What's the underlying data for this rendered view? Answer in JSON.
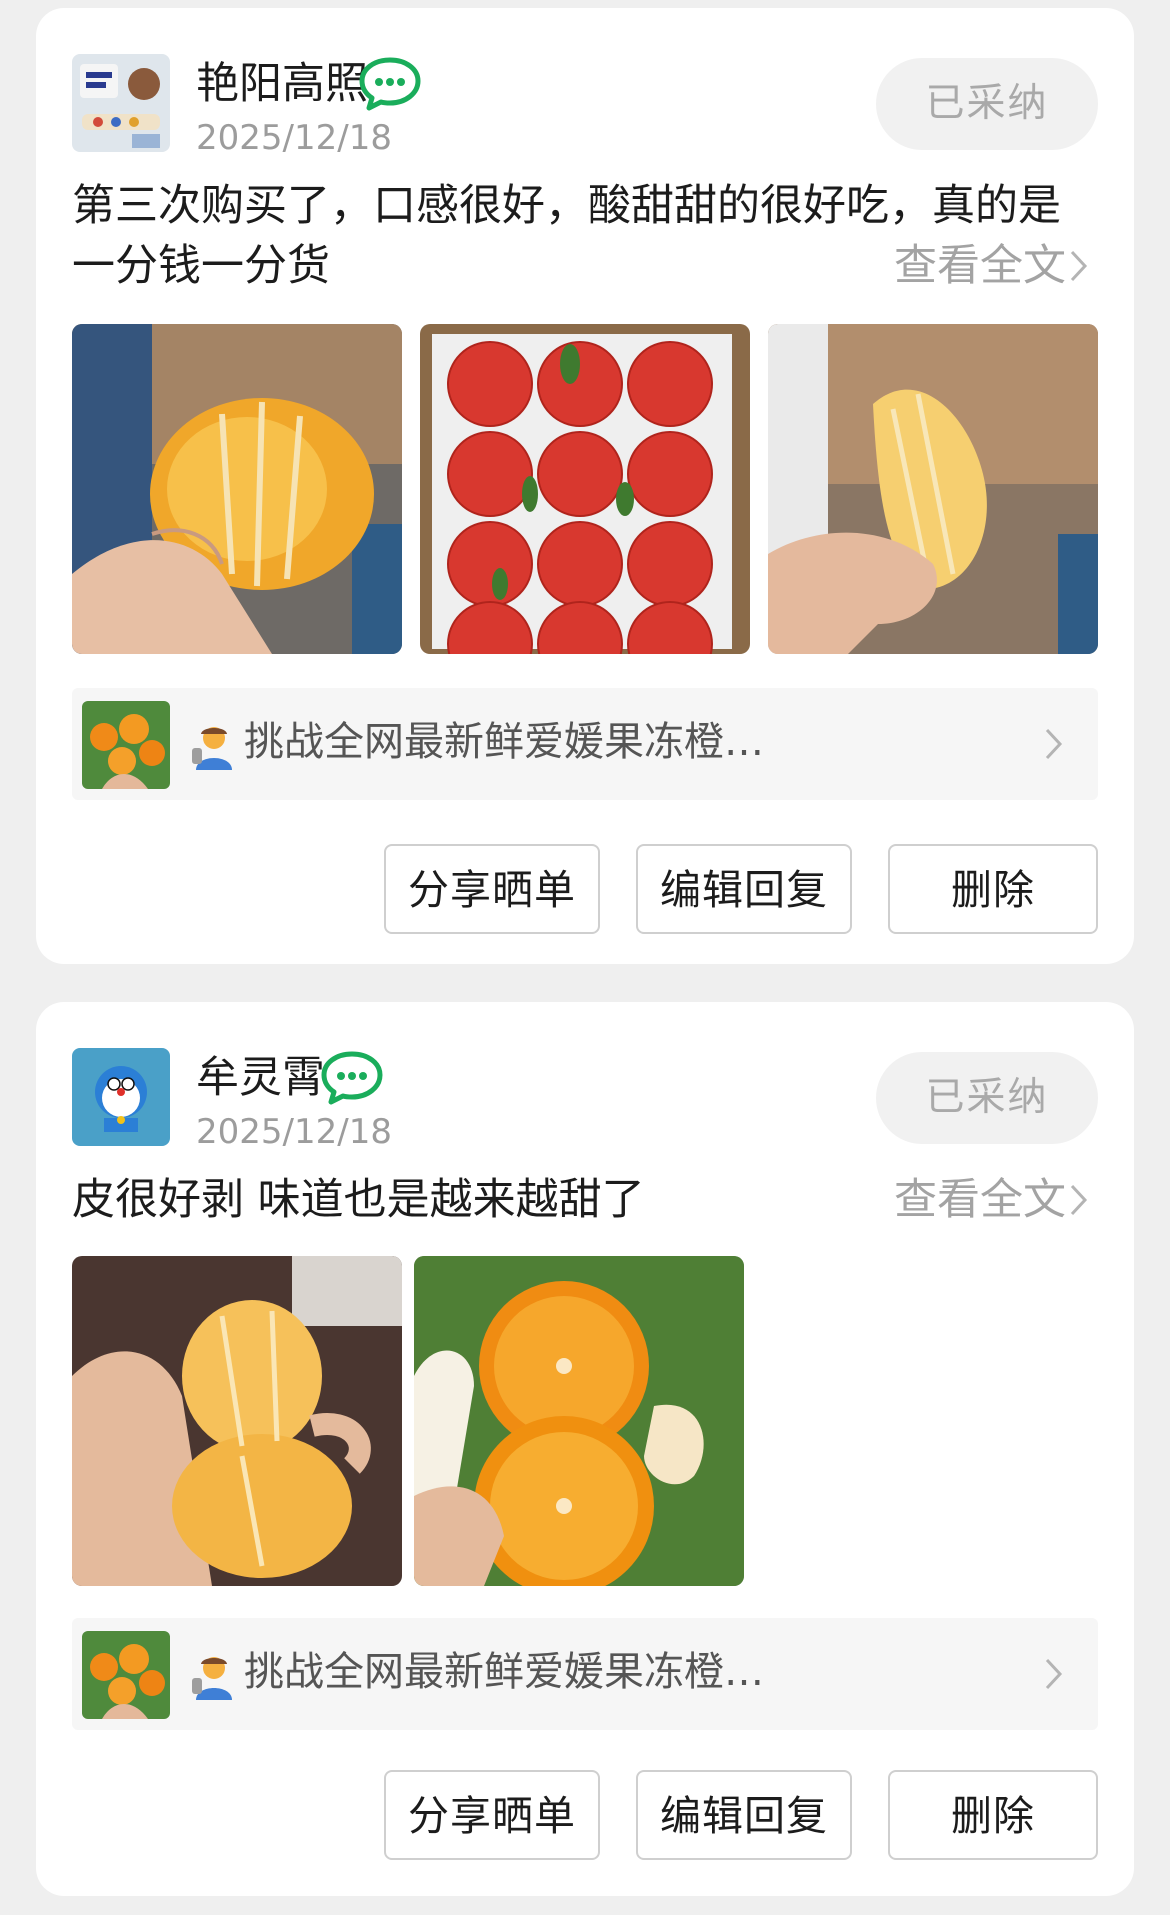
{
  "colors": {
    "accent_green": "#1aad5b",
    "adopted_bg": "#f1f1f1",
    "muted_text": "#a3a3a3"
  },
  "reviews": [
    {
      "username": "艳阳高照",
      "date": "2025/12/18",
      "status": "已采纳",
      "text": "第三次购买了，口感很好，酸甜甜的很好吃，真的是一分钱一分货",
      "read_more": "查看全文",
      "photos": [
        "peeled-orange-in-hand",
        "box-of-oranges-in-red-nets",
        "orange-segments-in-hand"
      ],
      "product": {
        "name": "挑战全网最新鲜爱媛果冻橙…",
        "icon": "farmer-icon"
      },
      "buttons": {
        "share": "分享晒单",
        "edit": "编辑回复",
        "delete": "删除"
      }
    },
    {
      "username": "牟灵霄",
      "date": "2025/12/18",
      "status": "已采纳",
      "text": "皮很好剥 味道也是越来越甜了",
      "read_more": "查看全文",
      "photos": [
        "peeled-oranges-in-hand",
        "halved-oranges-outdoors"
      ],
      "product": {
        "name": "挑战全网最新鲜爱媛果冻橙…",
        "icon": "farmer-icon"
      },
      "buttons": {
        "share": "分享晒单",
        "edit": "编辑回复",
        "delete": "删除"
      }
    }
  ]
}
